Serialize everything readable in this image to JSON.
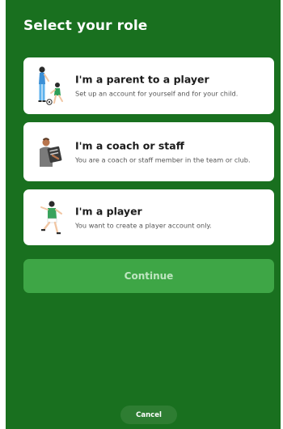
{
  "header": {
    "title": "Select your role"
  },
  "roles": [
    {
      "illustration": "parent-and-child-icon",
      "title": "I'm a parent to a player",
      "description": "Set up an account for yourself and for your child."
    },
    {
      "illustration": "coach-with-clipboard-icon",
      "title": "I'm a coach or staff",
      "description": "You are a coach or staff member in the team or club."
    },
    {
      "illustration": "player-running-icon",
      "title": "I'm a player",
      "description": "You want to create a player account only."
    }
  ],
  "actions": {
    "continue_label": "Continue",
    "cancel_label": "Cancel"
  },
  "colors": {
    "panel_background": "#19701f",
    "card_background": "#ffffff",
    "continue_button": "#3ea646",
    "continue_text": "#bfe6c1",
    "cancel_button": "#2e7d32"
  }
}
